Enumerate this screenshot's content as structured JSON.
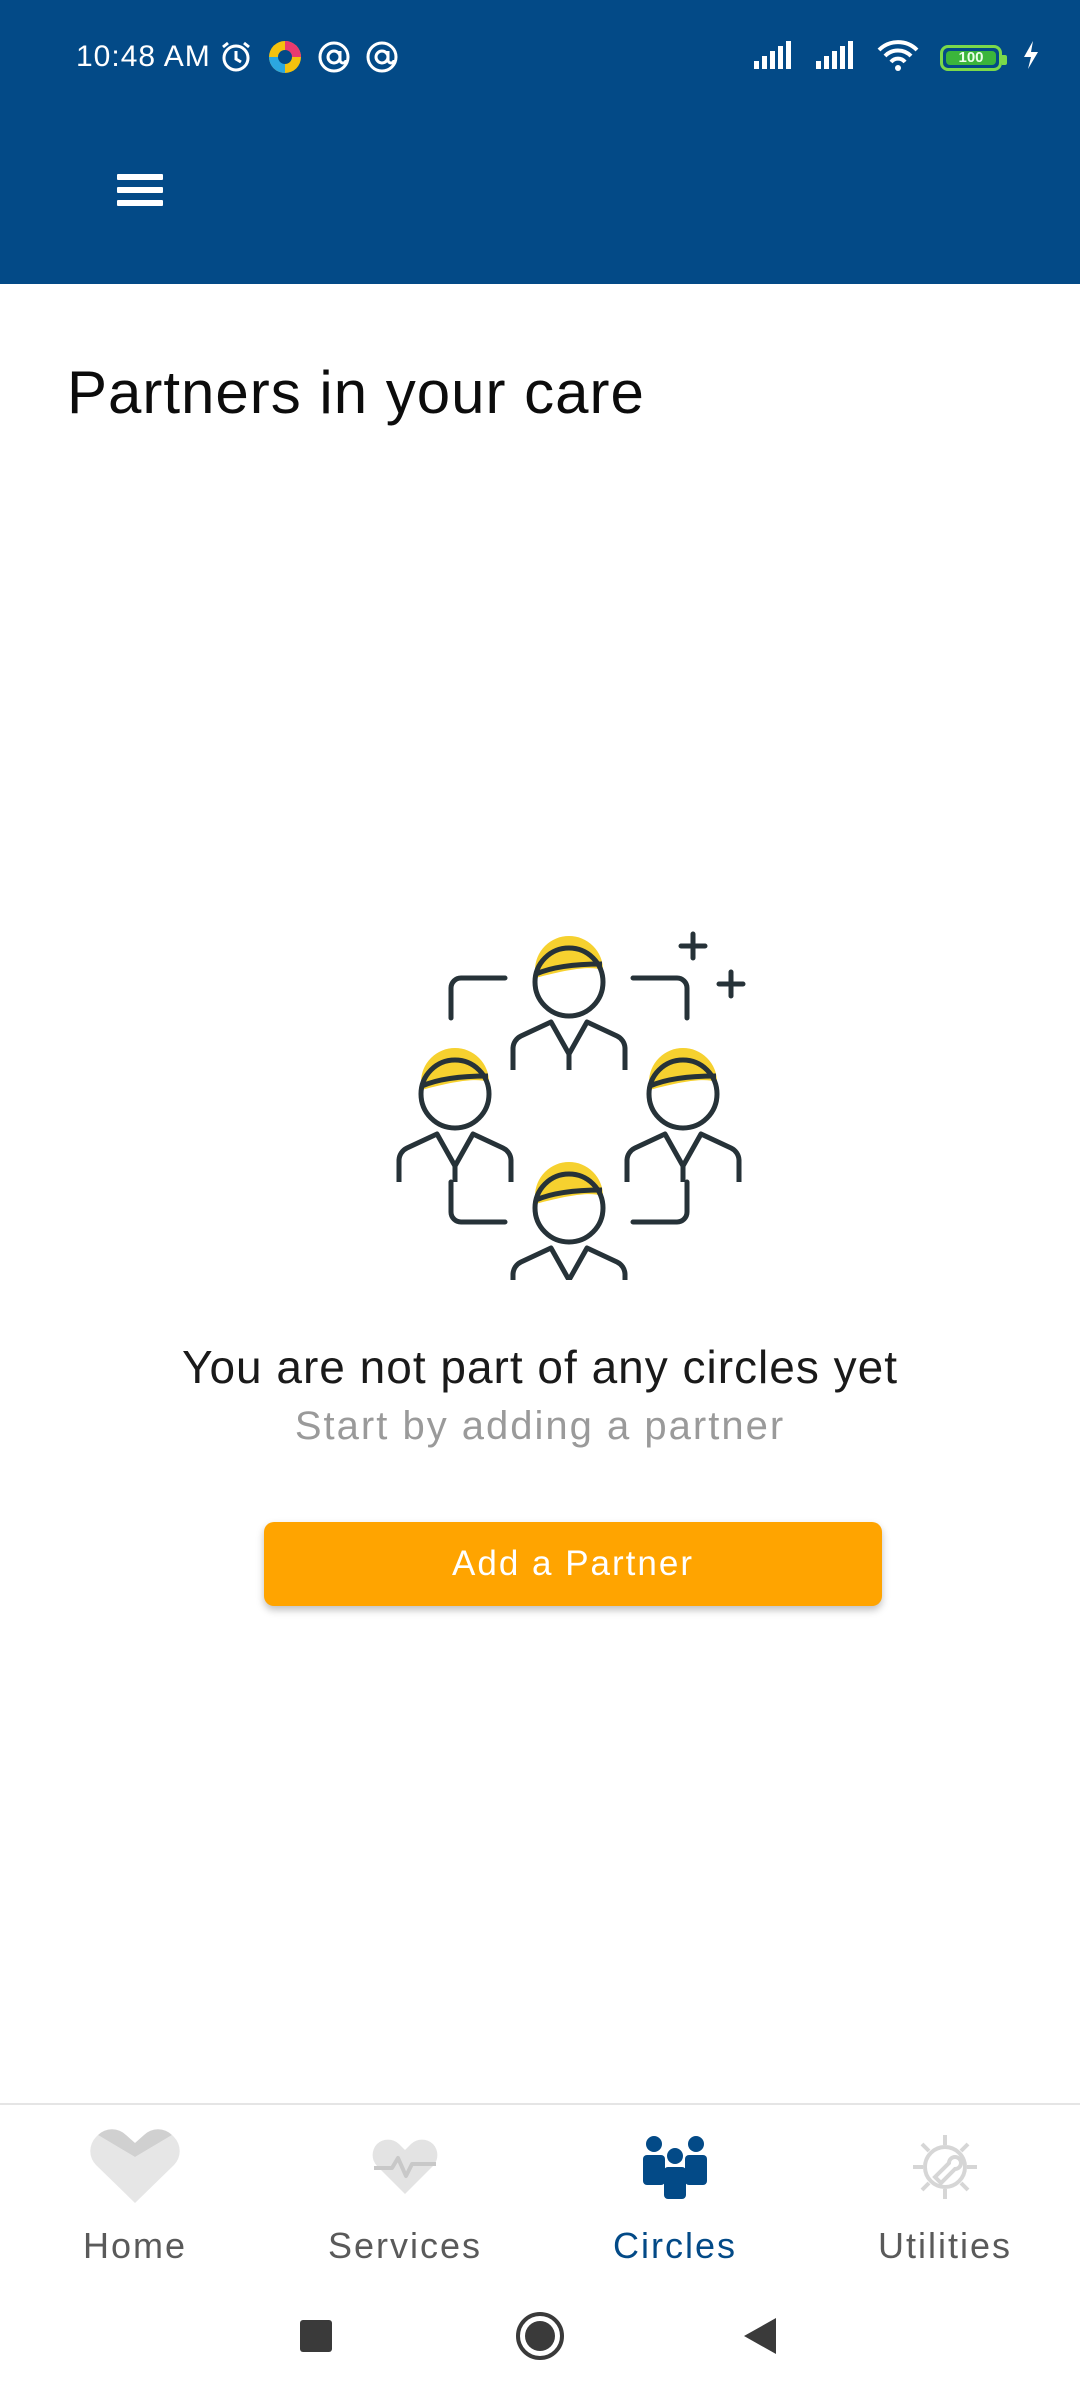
{
  "status_bar": {
    "time": "10:48 AM",
    "battery": "100",
    "left_icons": [
      "alarm-icon",
      "app-circle-icon",
      "at-icon",
      "at-icon"
    ],
    "right_icons": [
      "signal-icon",
      "signal-icon",
      "wifi-icon",
      "battery-icon",
      "charging-icon"
    ]
  },
  "header": {
    "background": "#034a87",
    "menu_icon": "hamburger-menu-icon"
  },
  "page": {
    "title": "Partners in your care"
  },
  "empty_state": {
    "illustration": "people-circle-illustration",
    "title": "You are not part of any circles yet",
    "subtitle": "Start by adding a partner",
    "button_label": "Add a Partner",
    "button_color": "#ffa400"
  },
  "bottom_nav": {
    "items": [
      {
        "label": "Home",
        "icon": "home-heart-icon",
        "active": false
      },
      {
        "label": "Services",
        "icon": "heartbeat-icon",
        "active": false
      },
      {
        "label": "Circles",
        "icon": "group-icon",
        "active": true
      },
      {
        "label": "Utilities",
        "icon": "gear-wrench-icon",
        "active": false
      }
    ],
    "active_color": "#034a87"
  },
  "system_nav": {
    "items": [
      "recents-icon",
      "home-icon",
      "back-icon"
    ]
  }
}
